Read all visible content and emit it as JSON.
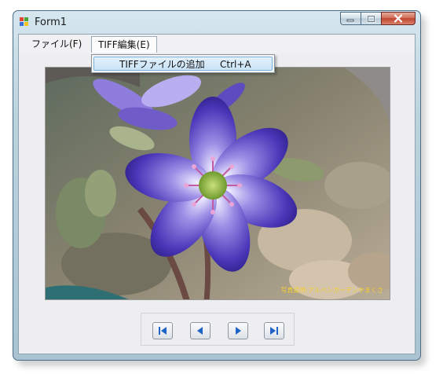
{
  "window": {
    "title": "Form1",
    "icon": "windows-form-icon",
    "caption_buttons": [
      "minimize-icon",
      "maximize-icon",
      "close-icon"
    ]
  },
  "menubar": {
    "items": [
      {
        "label": "ファイル(F)"
      },
      {
        "label": "TIFF編集(E)",
        "state": "open"
      }
    ]
  },
  "dropdown": {
    "items": [
      {
        "label": "TIFFファイルの追加",
        "shortcut": "Ctrl+A",
        "state": "highlighted"
      }
    ]
  },
  "picture": {
    "subject": "purple-hepatica-flower-photo",
    "caption": "写真提供:アルペンガーデンやまくさ"
  },
  "navigation": {
    "buttons": [
      {
        "name": "first-page-button",
        "icon": "first-page-icon"
      },
      {
        "name": "previous-page-button",
        "icon": "previous-page-icon"
      },
      {
        "name": "next-page-button",
        "icon": "next-page-icon"
      },
      {
        "name": "last-page-button",
        "icon": "last-page-icon"
      }
    ]
  },
  "colors": {
    "title_gradient": "#bcd3df",
    "menu_highlight": "#c9e3f7",
    "nav_arrow": "#1f63c6",
    "close_button": "#c0432e"
  }
}
